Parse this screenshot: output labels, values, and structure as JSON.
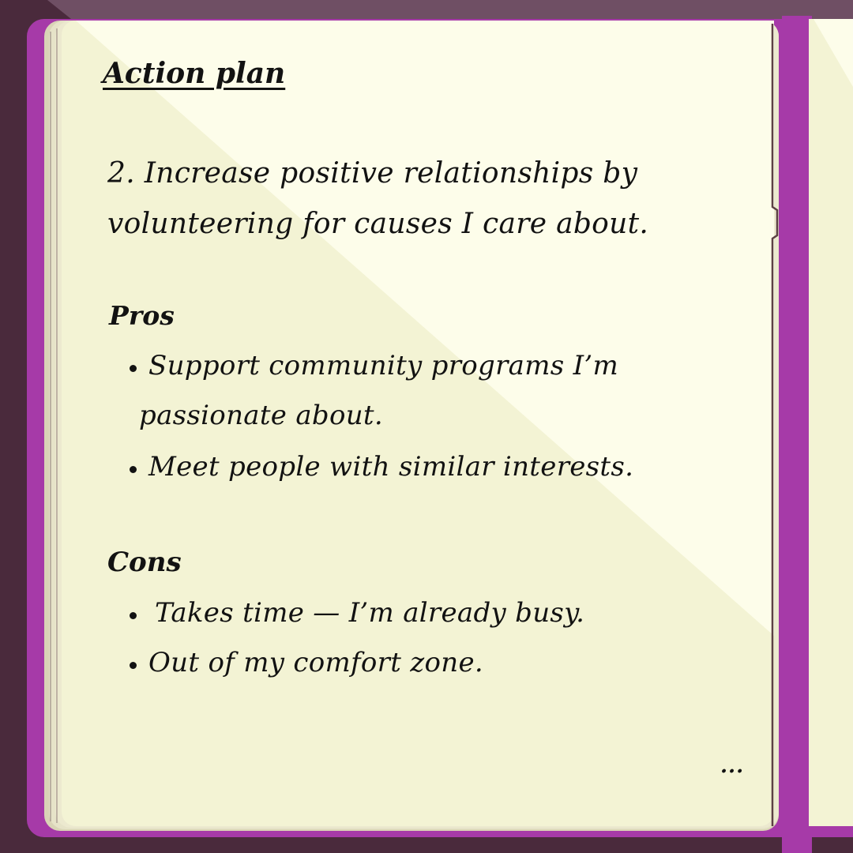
{
  "notebook": {
    "title": "Action plan",
    "goal_lines": [
      "2. Increase positive relationships by",
      "volunteering for causes I care about."
    ],
    "pros": {
      "heading": "Pros",
      "items": [
        {
          "lines": [
            "Support community programs I’m",
            "passionate about."
          ]
        },
        {
          "lines": [
            "Meet people with similar interests."
          ]
        }
      ]
    },
    "cons": {
      "heading": "Cons",
      "items": [
        {
          "lines": [
            "Takes time — I’m already busy."
          ]
        },
        {
          "lines": [
            "Out of my comfort zone."
          ]
        }
      ]
    },
    "continuation": "..."
  },
  "colors": {
    "background_dark": "#4a2a3c",
    "top_band": "#6f4f64",
    "cover_purple": "#a63aa8",
    "page_light": "#fdfdea",
    "page_shadow": "#f3f3d4",
    "page_edges": "#e6e3c8",
    "ink": "#121212"
  }
}
